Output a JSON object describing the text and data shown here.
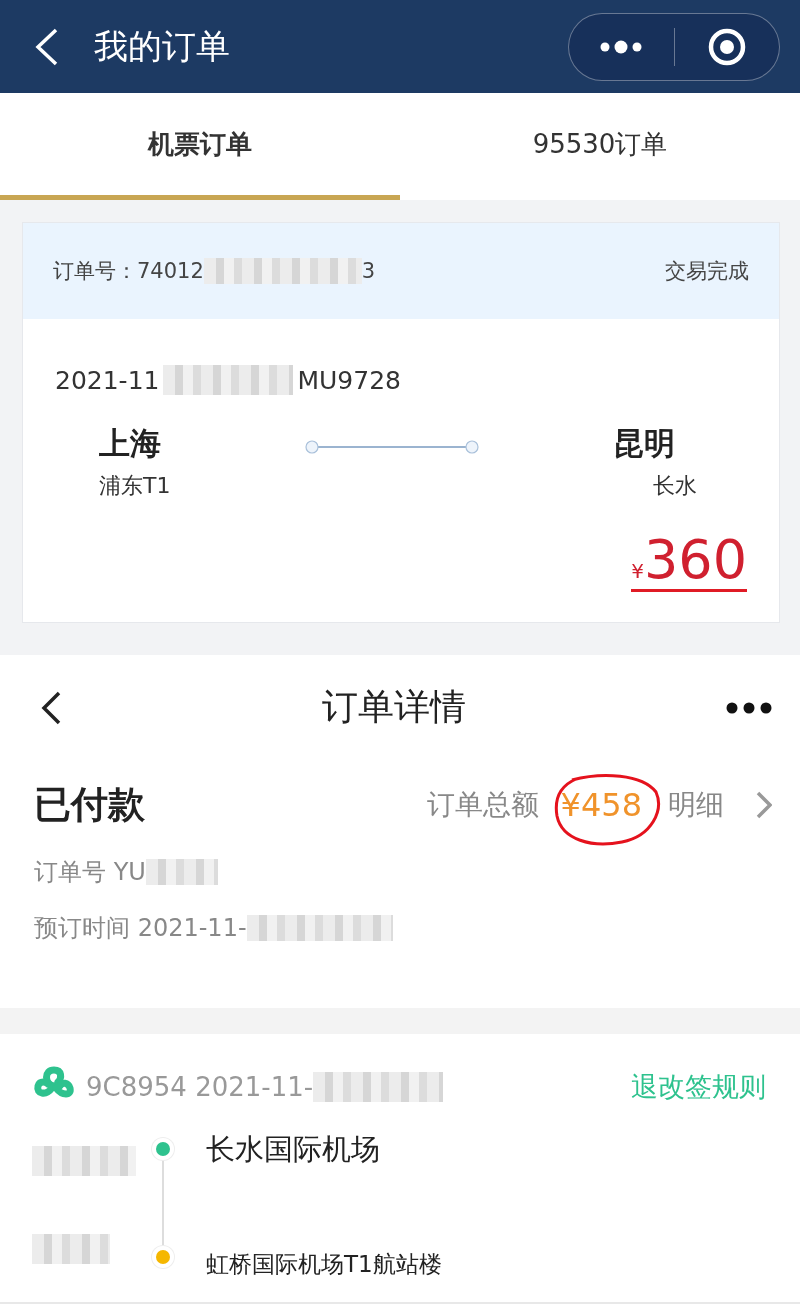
{
  "header": {
    "title": "我的订单"
  },
  "tabs": [
    {
      "label": "机票订单",
      "selected": true
    },
    {
      "label": "95530订单",
      "selected": false
    }
  ],
  "order_card": {
    "order_no_prefix": "订单号：74012",
    "order_no_suffix": "3",
    "status": "交易完成",
    "date_prefix": "2021-11",
    "flight_no": "MU9728",
    "origin": {
      "city": "上海",
      "airport": "浦东T1"
    },
    "destination": {
      "city": "昆明",
      "airport": "长水"
    },
    "currency": "¥",
    "price": "360"
  },
  "detail": {
    "title": "订单详情",
    "status": "已付款",
    "total_label": "订单总额",
    "total": "¥458",
    "detail_link": "明细",
    "order_no_prefix": "订单号 YU",
    "booking_prefix": "预订时间 2021-11-"
  },
  "segment": {
    "flight_prefix": "9C8954 2021-11-",
    "rules_link": "退改签规则",
    "stops": [
      {
        "airport": "长水国际机场",
        "color": "#2ec28e"
      },
      {
        "airport": "虹桥国际机场T1航站楼",
        "color": "#f5b700"
      }
    ]
  }
}
